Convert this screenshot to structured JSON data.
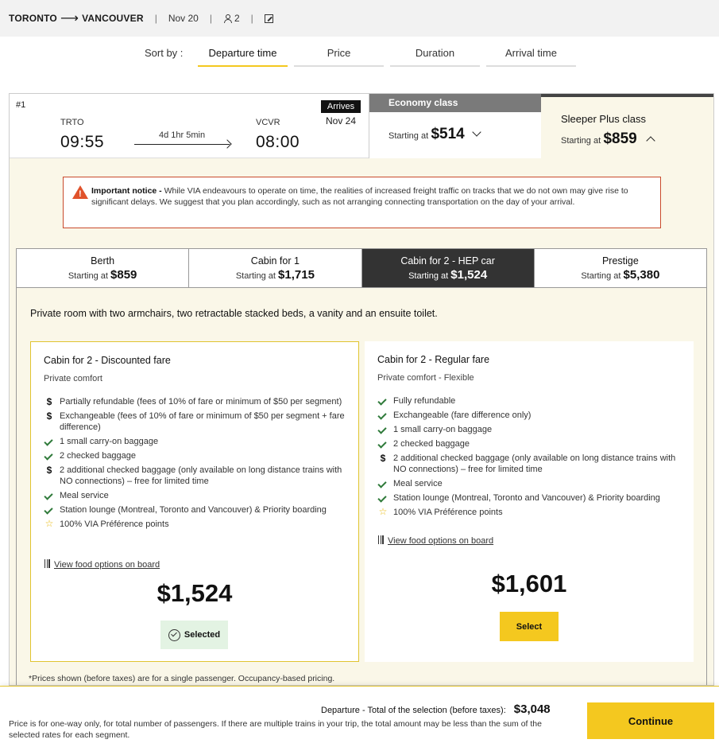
{
  "header": {
    "origin": "TORONTO",
    "destination": "VANCOUVER",
    "date": "Nov 20",
    "passengers": "2"
  },
  "sort": {
    "label": "Sort by :",
    "options": [
      "Departure time",
      "Price",
      "Duration",
      "Arrival time"
    ],
    "active": "Departure time"
  },
  "trip": {
    "number": "#1",
    "from_code": "TRTO",
    "depart_time": "09:55",
    "duration": "4d 1hr 5min",
    "to_code": "VCVR",
    "arrive_time": "08:00",
    "arrives_label": "Arrives",
    "arrives_date": "Nov 24"
  },
  "classes": {
    "economy": {
      "name": "Economy class",
      "starting_label": "Starting at",
      "price": "$514"
    },
    "sleeper": {
      "name": "Sleeper Plus class",
      "starting_label": "Starting at",
      "price": "$859"
    }
  },
  "notice": {
    "title": "Important notice -",
    "text": " While VIA endeavours to operate on time, the realities of increased freight traffic on tracks that we do not own may give rise to significant delays. We suggest that you plan accordingly, such as not arranging connecting transportation on the day of your arrival."
  },
  "cabins": [
    {
      "name": "Berth",
      "starting_label": "Starting at",
      "price": "$859"
    },
    {
      "name": "Cabin for 1",
      "starting_label": "Starting at",
      "price": "$1,715"
    },
    {
      "name": "Cabin for 2 - HEP car",
      "starting_label": "Starting at",
      "price": "$1,524"
    },
    {
      "name": "Prestige",
      "starting_label": "Starting at",
      "price": "$5,380"
    }
  ],
  "cabin_description": "Private room with two armchairs, two retractable stacked beds, a vanity and an ensuite toilet.",
  "fares": {
    "discounted": {
      "title": "Cabin for 2 - Discounted fare",
      "subtitle": "Private comfort",
      "features": [
        {
          "icon": "dollar-icon",
          "text": "Partially refundable (fees of 10% of fare or minimum of $50 per segment)"
        },
        {
          "icon": "dollar-icon",
          "text": "Exchangeable (fees of 10% of fare or minimum of $50 per segment + fare difference)"
        },
        {
          "icon": "check-icon",
          "text": "1 small carry-on baggage"
        },
        {
          "icon": "check-icon",
          "text": "2 checked baggage"
        },
        {
          "icon": "dollar-icon",
          "text": "2 additional checked baggage (only available on long distance trains with NO connections) – free for limited time"
        },
        {
          "icon": "check-icon",
          "text": "Meal service"
        },
        {
          "icon": "check-icon",
          "text": "Station lounge (Montreal, Toronto and Vancouver) & Priority boarding"
        },
        {
          "icon": "star-icon",
          "text": "100% VIA Préférence points"
        }
      ],
      "food_link": "View food options on board",
      "price": "$1,524",
      "button": "Selected"
    },
    "regular": {
      "title": "Cabin for 2 - Regular fare",
      "subtitle": "Private comfort - Flexible",
      "features": [
        {
          "icon": "check-icon",
          "text": "Fully refundable"
        },
        {
          "icon": "check-icon",
          "text": "Exchangeable (fare difference only)"
        },
        {
          "icon": "check-icon",
          "text": "1 small carry-on baggage"
        },
        {
          "icon": "check-icon",
          "text": "2 checked baggage"
        },
        {
          "icon": "dollar-icon",
          "text": "2 additional checked baggage (only available on long distance trains with NO connections) – free for limited time"
        },
        {
          "icon": "check-icon",
          "text": "Meal service"
        },
        {
          "icon": "check-icon",
          "text": "Station lounge (Montreal, Toronto and Vancouver) & Priority boarding"
        },
        {
          "icon": "star-icon",
          "text": "100% VIA Préférence points"
        }
      ],
      "food_link": "View food options on board",
      "price": "$1,601",
      "button": "Select"
    }
  },
  "footnote": "*Prices shown (before taxes) are for a single passenger. Occupancy-based pricing.",
  "bottom": {
    "total_label": "Departure - Total of the selection (before taxes):",
    "total": "$3,048",
    "note": "Price is for one-way only, for total number of passengers. If there are multiple trains in your trip, the total amount may be less than the sum of the selected rates for each segment.",
    "continue": "Continue"
  }
}
